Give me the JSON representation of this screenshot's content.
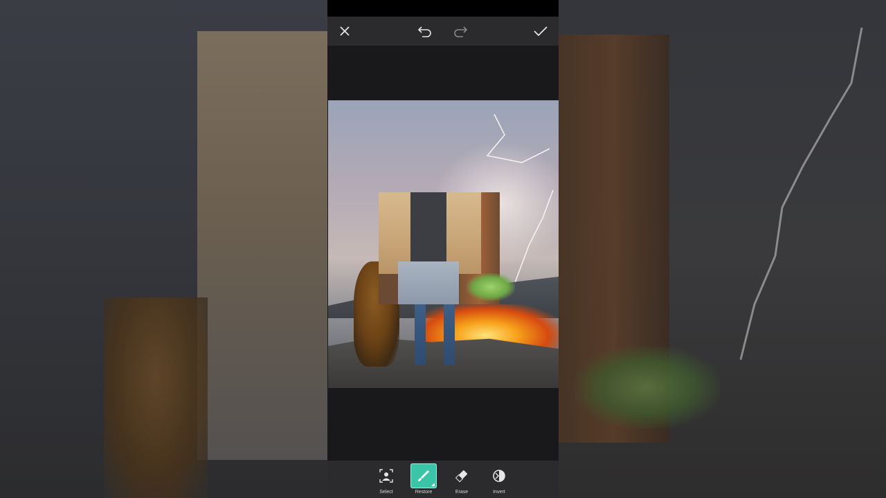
{
  "header": {
    "buttons": [
      {
        "name": "close",
        "icon": "close-icon"
      },
      {
        "name": "undo",
        "icon": "undo-icon"
      },
      {
        "name": "redo",
        "icon": "redo-icon"
      },
      {
        "name": "apply",
        "icon": "checkmark-icon"
      }
    ]
  },
  "toolbar": {
    "tools": [
      {
        "label": "Select",
        "icon": "person-select-icon",
        "active": false
      },
      {
        "label": "Restore",
        "icon": "brush-icon",
        "active": true
      },
      {
        "label": "Erase",
        "icon": "eraser-icon",
        "active": false
      },
      {
        "label": "Invert",
        "icon": "invert-icon",
        "active": false
      }
    ]
  },
  "colors": {
    "accent": "#3bc5a8",
    "bar_bg": "#2b2b2e",
    "icon": "#e6e6e6"
  }
}
